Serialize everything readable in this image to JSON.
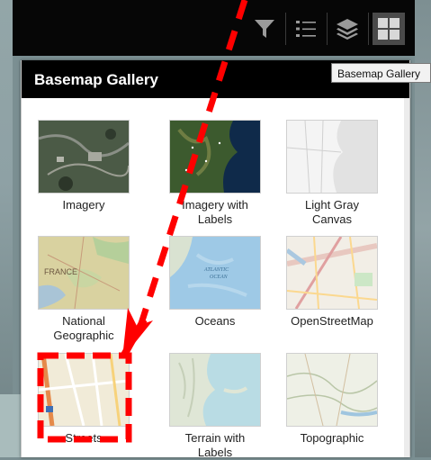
{
  "toolbar": {
    "buttons": [
      {
        "name": "filter-icon"
      },
      {
        "name": "legend-list-icon"
      },
      {
        "name": "layers-icon"
      },
      {
        "name": "basemap-gallery-icon"
      }
    ],
    "active_color": "#4a4a4a"
  },
  "tooltip": {
    "text": "Basemap Gallery"
  },
  "panel": {
    "title": "Basemap Gallery"
  },
  "basemaps": [
    {
      "label_line1": "Imagery",
      "label_line2": ""
    },
    {
      "label_line1": "Imagery with",
      "label_line2": "Labels"
    },
    {
      "label_line1": "Light Gray",
      "label_line2": "Canvas"
    },
    {
      "label_line1": "National",
      "label_line2": "Geographic"
    },
    {
      "label_line1": "Oceans",
      "label_line2": ""
    },
    {
      "label_line1": "OpenStreetMap",
      "label_line2": ""
    },
    {
      "label_line1": "Streets",
      "label_line2": ""
    },
    {
      "label_line1": "Terrain with",
      "label_line2": "Labels"
    },
    {
      "label_line1": "Topographic",
      "label_line2": ""
    }
  ],
  "annotation": {
    "color": "#ff0000"
  }
}
